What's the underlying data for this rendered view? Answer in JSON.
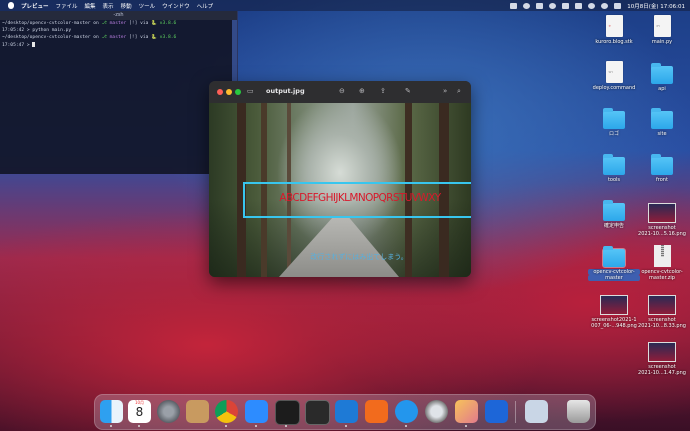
{
  "menubar": {
    "app_name": "プレビュー",
    "menus": [
      "ファイル",
      "編集",
      "表示",
      "移動",
      "ツール",
      "ウインドウ",
      "ヘルプ"
    ],
    "clock": "10月8日(金)  17:06:01"
  },
  "terminal": {
    "title": "-zsh",
    "lines": [
      {
        "path": "~/desktop/opencv-cvtcolor-master",
        "on": " on ",
        "branch": "master",
        "status": " [!] via ",
        "ver": "v3.8.6"
      },
      {
        "prompt": "17:05:42 > python main.py"
      },
      {
        "path": "~/desktop/opencv-cvtcolor-master",
        "on": " on ",
        "branch": "master",
        "status": " [!] via ",
        "ver": "v3.8.6"
      },
      {
        "prompt": "17:05:47 > "
      }
    ]
  },
  "preview": {
    "title": "output.jpg",
    "image": {
      "overlay_text": "ABCDEFGHIJKLMNOPQRSTUVWXY",
      "sub_text": "改行されずにはみ出てしまう。"
    },
    "colors": {
      "box": "#38c6ee",
      "text": "#d8192b",
      "sub": "#55b0e0"
    }
  },
  "desktop_icons": [
    {
      "label": "kuroro.blog.stk",
      "icon": "doc-icon"
    },
    {
      "label": "main.py",
      "icon": "doc-icon"
    },
    {
      "label": "deploy.command",
      "icon": "doc-icon"
    },
    {
      "label": "api",
      "icon": "folder-icon"
    },
    {
      "label": "ロゴ",
      "icon": "folder-icon"
    },
    {
      "label": "site",
      "icon": "folder-icon"
    },
    {
      "label": "tools",
      "icon": "folder-icon"
    },
    {
      "label": "front",
      "icon": "folder-icon"
    },
    {
      "label": "確定申告",
      "icon": "folder-icon"
    },
    {
      "label": "screenshot",
      "label2": "2021-10...5.16.png",
      "icon": "image-icon"
    },
    {
      "label": "opencv-cvtcolor-",
      "label2": "master",
      "icon": "folder-icon"
    },
    {
      "label": "opencv-cvtcolor-",
      "label2": "master.zip",
      "icon": "zip-icon"
    },
    {
      "label": "screenshot2021-1",
      "label2": "007_06-...948.png",
      "icon": "image-icon"
    },
    {
      "label": "screenshot",
      "label2": "2021-10...8.33.png",
      "icon": "image-icon"
    },
    {
      "label": "screenshot",
      "label2": "2021-10...1.47.png",
      "icon": "image-icon"
    }
  ],
  "dock": {
    "calendar_month": "10月",
    "calendar_day": "8",
    "apps": [
      "finder-icon",
      "calendar-icon",
      "system-preferences-icon",
      "contacts-icon",
      "chrome-icon",
      "zoom-icon",
      "terminal-icon",
      "iterm-icon",
      "vscode-icon",
      "sourcetree-icon",
      "docker-icon",
      "quicktime-icon",
      "preview-icon",
      "infinity-icon",
      "downloads-icon",
      "trash-icon"
    ]
  }
}
